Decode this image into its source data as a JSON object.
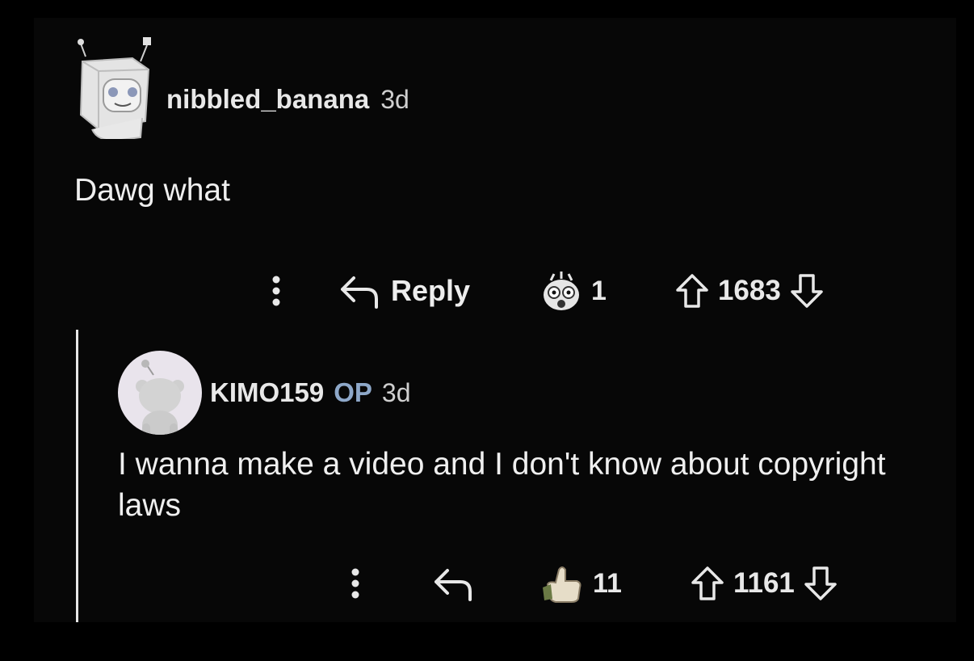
{
  "comment": {
    "username": "nibbled_banana",
    "age": "3d",
    "body": "Dawg what",
    "actions": {
      "more_icon": "three-dots-vertical-icon",
      "reply_icon": "reply-arrow-icon",
      "reply_label": "Reply",
      "award_icon": "shocked-face-award-icon",
      "award_count": "1",
      "upvote_icon": "arrow-up-icon",
      "score": "1683",
      "downvote_icon": "arrow-down-icon"
    }
  },
  "reply": {
    "username": "KIMO159",
    "op_badge": "OP",
    "age": "3d",
    "body": "I wanna make a video and I don't know about copyright laws",
    "actions": {
      "more_icon": "three-dots-vertical-icon",
      "reply_icon": "reply-arrow-icon",
      "award_icon": "thumbs-up-hand-award-icon",
      "award_count": "11",
      "upvote_icon": "arrow-up-icon",
      "score": "1161",
      "downvote_icon": "arrow-down-icon"
    }
  },
  "colors": {
    "background": "#000000",
    "panel": "#070707",
    "text": "#ededed",
    "op_badge": "#8ea8c9",
    "thread_line": "#e6e6e6",
    "snoo_avatar_bg": "#e9e4ec"
  }
}
